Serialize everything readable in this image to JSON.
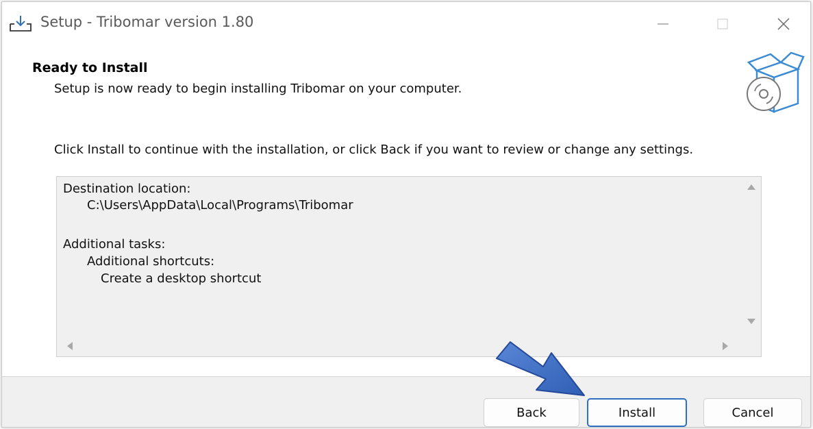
{
  "window": {
    "title": "Setup - Tribomar version 1.80"
  },
  "header": {
    "title": "Ready to Install",
    "subtitle": "Setup is now ready to begin installing Tribomar on your computer."
  },
  "instruction": "Click Install to continue with the installation, or click Back if you want to review or change any settings.",
  "memo": {
    "lines": [
      "Destination location:",
      "C:\\Users\\AppData\\Local\\Programs\\Tribomar",
      "",
      "Additional tasks:",
      "Additional shortcuts:",
      "Create a desktop shortcut"
    ]
  },
  "buttons": {
    "back": "Back",
    "install": "Install",
    "cancel": "Cancel"
  },
  "icons": {
    "title": "download-icon",
    "header": "software-box-icon",
    "annotation": "blue-arrow-icon"
  },
  "colors": {
    "accent": "#2f6fc2",
    "arrow": "#3f6fc5",
    "footer": "#f0f0f0"
  }
}
